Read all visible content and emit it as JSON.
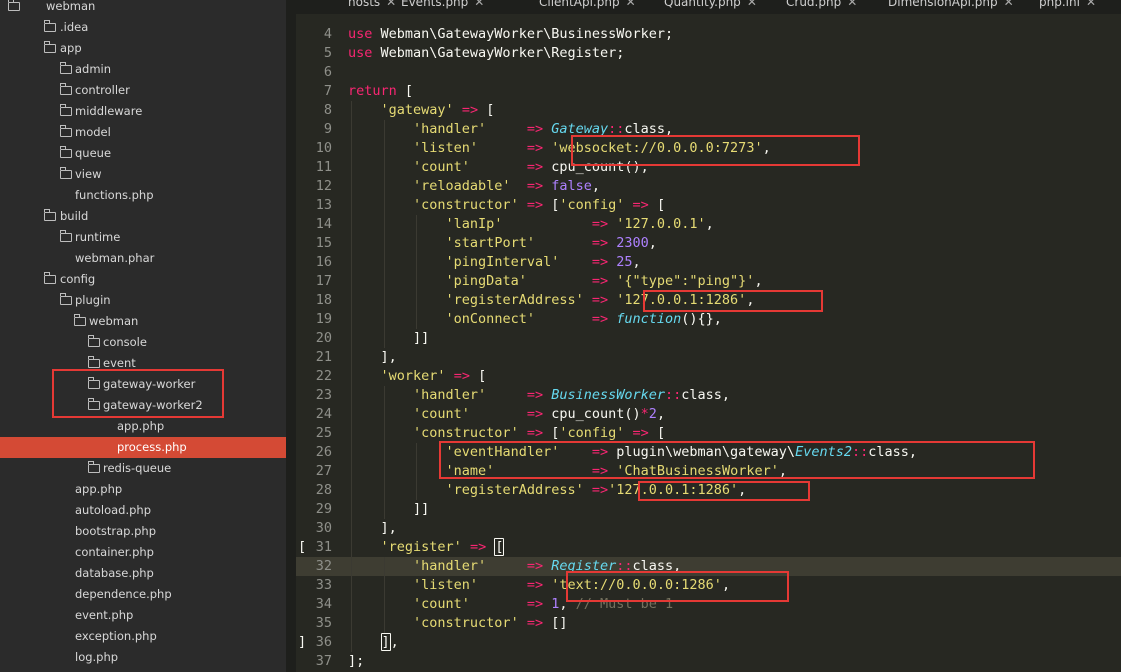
{
  "tabs": [
    {
      "label": "hosts",
      "close": "✕"
    },
    {
      "label": "Events.php",
      "close": "✕"
    },
    {
      "label": "ClientApi.php",
      "close": "✕"
    },
    {
      "label": "Quantity.php",
      "close": "✕"
    },
    {
      "label": "Crud.php",
      "close": "✕"
    },
    {
      "label": "DimensionApi.php",
      "close": "✕"
    },
    {
      "label": "php.ini",
      "close": "✕"
    }
  ],
  "sidebar": {
    "items": [
      {
        "label": "webman",
        "kind": "folder-open"
      },
      {
        "label": ".idea",
        "kind": "folder"
      },
      {
        "label": "app",
        "kind": "folder-open"
      },
      {
        "label": "admin",
        "kind": "folder"
      },
      {
        "label": "controller",
        "kind": "folder"
      },
      {
        "label": "middleware",
        "kind": "folder"
      },
      {
        "label": "model",
        "kind": "folder"
      },
      {
        "label": "queue",
        "kind": "folder"
      },
      {
        "label": "view",
        "kind": "folder"
      },
      {
        "label": "functions.php",
        "kind": "file"
      },
      {
        "label": "build",
        "kind": "folder-open"
      },
      {
        "label": "runtime",
        "kind": "folder"
      },
      {
        "label": "webman.phar",
        "kind": "file"
      },
      {
        "label": "config",
        "kind": "folder-open"
      },
      {
        "label": "plugin",
        "kind": "folder-open"
      },
      {
        "label": "webman",
        "kind": "folder-open"
      },
      {
        "label": "console",
        "kind": "folder"
      },
      {
        "label": "event",
        "kind": "folder"
      },
      {
        "label": "gateway-worker",
        "kind": "folder"
      },
      {
        "label": "gateway-worker2",
        "kind": "folder-open"
      },
      {
        "label": "app.php",
        "kind": "file"
      },
      {
        "label": "process.php",
        "kind": "file",
        "selected": true
      },
      {
        "label": "redis-queue",
        "kind": "folder"
      },
      {
        "label": "app.php",
        "kind": "file"
      },
      {
        "label": "autoload.php",
        "kind": "file"
      },
      {
        "label": "bootstrap.php",
        "kind": "file"
      },
      {
        "label": "container.php",
        "kind": "file"
      },
      {
        "label": "database.php",
        "kind": "file"
      },
      {
        "label": "dependence.php",
        "kind": "file"
      },
      {
        "label": "event.php",
        "kind": "file"
      },
      {
        "label": "exception.php",
        "kind": "file"
      },
      {
        "label": "log.php",
        "kind": "file"
      }
    ]
  },
  "editor": {
    "current_line": "32",
    "lines": [
      {
        "num": "4",
        "tokens": [
          [
            "kw",
            "use"
          ],
          [
            "txt",
            " Webman\\GatewayWorker\\BusinessWorker;"
          ]
        ]
      },
      {
        "num": "5",
        "tokens": [
          [
            "kw",
            "use"
          ],
          [
            "txt",
            " Webman\\GatewayWorker\\Register;"
          ]
        ]
      },
      {
        "num": "6",
        "tokens": []
      },
      {
        "num": "7",
        "tokens": [
          [
            "kw",
            "return"
          ],
          [
            "txt",
            " ["
          ]
        ]
      },
      {
        "num": "8",
        "tokens": [
          [
            "txt",
            "    "
          ],
          [
            "str",
            "'gateway'"
          ],
          [
            "txt",
            " "
          ],
          [
            "op",
            "=>"
          ],
          [
            "txt",
            " ["
          ]
        ]
      },
      {
        "num": "9",
        "tokens": [
          [
            "txt",
            "        "
          ],
          [
            "str",
            "'handler'"
          ],
          [
            "txt",
            "     "
          ],
          [
            "op",
            "=>"
          ],
          [
            "txt",
            " "
          ],
          [
            "cls",
            "Gateway"
          ],
          [
            "op",
            "::"
          ],
          [
            "txt",
            "class,"
          ]
        ]
      },
      {
        "num": "10",
        "tokens": [
          [
            "txt",
            "        "
          ],
          [
            "str",
            "'listen'"
          ],
          [
            "txt",
            "      "
          ],
          [
            "op",
            "=>"
          ],
          [
            "txt",
            " "
          ],
          [
            "str",
            "'websocket://0.0.0.0:7273'"
          ],
          [
            "txt",
            ","
          ]
        ]
      },
      {
        "num": "11",
        "tokens": [
          [
            "txt",
            "        "
          ],
          [
            "str",
            "'count'"
          ],
          [
            "txt",
            "       "
          ],
          [
            "op",
            "=>"
          ],
          [
            "txt",
            " cpu_count(),"
          ]
        ]
      },
      {
        "num": "12",
        "tokens": [
          [
            "txt",
            "        "
          ],
          [
            "str",
            "'reloadable'"
          ],
          [
            "txt",
            "  "
          ],
          [
            "op",
            "=>"
          ],
          [
            "txt",
            " "
          ],
          [
            "num",
            "false"
          ],
          [
            "txt",
            ","
          ]
        ]
      },
      {
        "num": "13",
        "tokens": [
          [
            "txt",
            "        "
          ],
          [
            "str",
            "'constructor'"
          ],
          [
            "txt",
            " "
          ],
          [
            "op",
            "=>"
          ],
          [
            "txt",
            " ["
          ],
          [
            "str",
            "'config'"
          ],
          [
            "txt",
            " "
          ],
          [
            "op",
            "=>"
          ],
          [
            "txt",
            " ["
          ]
        ]
      },
      {
        "num": "14",
        "tokens": [
          [
            "txt",
            "            "
          ],
          [
            "str",
            "'lanIp'"
          ],
          [
            "txt",
            "           "
          ],
          [
            "op",
            "=>"
          ],
          [
            "txt",
            " "
          ],
          [
            "str",
            "'127.0.0.1'"
          ],
          [
            "txt",
            ","
          ]
        ]
      },
      {
        "num": "15",
        "tokens": [
          [
            "txt",
            "            "
          ],
          [
            "str",
            "'startPort'"
          ],
          [
            "txt",
            "       "
          ],
          [
            "op",
            "=>"
          ],
          [
            "txt",
            " "
          ],
          [
            "num",
            "2300"
          ],
          [
            "txt",
            ","
          ]
        ]
      },
      {
        "num": "16",
        "tokens": [
          [
            "txt",
            "            "
          ],
          [
            "str",
            "'pingInterval'"
          ],
          [
            "txt",
            "    "
          ],
          [
            "op",
            "=>"
          ],
          [
            "txt",
            " "
          ],
          [
            "num",
            "25"
          ],
          [
            "txt",
            ","
          ]
        ]
      },
      {
        "num": "17",
        "tokens": [
          [
            "txt",
            "            "
          ],
          [
            "str",
            "'pingData'"
          ],
          [
            "txt",
            "        "
          ],
          [
            "op",
            "=>"
          ],
          [
            "txt",
            " "
          ],
          [
            "str",
            "'{\"type\":\"ping\"}'"
          ],
          [
            "txt",
            ","
          ]
        ]
      },
      {
        "num": "18",
        "tokens": [
          [
            "txt",
            "            "
          ],
          [
            "str",
            "'registerAddress'"
          ],
          [
            "txt",
            " "
          ],
          [
            "op",
            "=>"
          ],
          [
            "txt",
            " "
          ],
          [
            "str",
            "'127.0.0.1:1286'"
          ],
          [
            "txt",
            ","
          ]
        ]
      },
      {
        "num": "19",
        "tokens": [
          [
            "txt",
            "            "
          ],
          [
            "str",
            "'onConnect'"
          ],
          [
            "txt",
            "       "
          ],
          [
            "op",
            "=>"
          ],
          [
            "txt",
            " "
          ],
          [
            "cls",
            "function"
          ],
          [
            "txt",
            "(){},"
          ]
        ]
      },
      {
        "num": "20",
        "tokens": [
          [
            "txt",
            "        ]]"
          ]
        ]
      },
      {
        "num": "21",
        "tokens": [
          [
            "txt",
            "    ],"
          ]
        ]
      },
      {
        "num": "22",
        "tokens": [
          [
            "txt",
            "    "
          ],
          [
            "str",
            "'worker'"
          ],
          [
            "txt",
            " "
          ],
          [
            "op",
            "=>"
          ],
          [
            "txt",
            " ["
          ]
        ]
      },
      {
        "num": "23",
        "tokens": [
          [
            "txt",
            "        "
          ],
          [
            "str",
            "'handler'"
          ],
          [
            "txt",
            "     "
          ],
          [
            "op",
            "=>"
          ],
          [
            "txt",
            " "
          ],
          [
            "cls",
            "BusinessWorker"
          ],
          [
            "op",
            "::"
          ],
          [
            "txt",
            "class,"
          ]
        ]
      },
      {
        "num": "24",
        "tokens": [
          [
            "txt",
            "        "
          ],
          [
            "str",
            "'count'"
          ],
          [
            "txt",
            "       "
          ],
          [
            "op",
            "=>"
          ],
          [
            "txt",
            " cpu_count()"
          ],
          [
            "op",
            "*"
          ],
          [
            "num",
            "2"
          ],
          [
            "txt",
            ","
          ]
        ]
      },
      {
        "num": "25",
        "tokens": [
          [
            "txt",
            "        "
          ],
          [
            "str",
            "'constructor'"
          ],
          [
            "txt",
            " "
          ],
          [
            "op",
            "=>"
          ],
          [
            "txt",
            " ["
          ],
          [
            "str",
            "'config'"
          ],
          [
            "txt",
            " "
          ],
          [
            "op",
            "=>"
          ],
          [
            "txt",
            " ["
          ]
        ]
      },
      {
        "num": "26",
        "tokens": [
          [
            "txt",
            "            "
          ],
          [
            "str",
            "'eventHandler'"
          ],
          [
            "txt",
            "    "
          ],
          [
            "op",
            "=>"
          ],
          [
            "txt",
            " plugin\\webman\\gateway\\"
          ],
          [
            "cls",
            "Events2"
          ],
          [
            "op",
            "::"
          ],
          [
            "txt",
            "class,"
          ]
        ]
      },
      {
        "num": "27",
        "tokens": [
          [
            "txt",
            "            "
          ],
          [
            "str",
            "'name'"
          ],
          [
            "txt",
            "            "
          ],
          [
            "op",
            "=>"
          ],
          [
            "txt",
            " "
          ],
          [
            "str",
            "'ChatBusinessWorker'"
          ],
          [
            "txt",
            ","
          ]
        ]
      },
      {
        "num": "28",
        "tokens": [
          [
            "txt",
            "            "
          ],
          [
            "str",
            "'registerAddress'"
          ],
          [
            "txt",
            " "
          ],
          [
            "op",
            "=>"
          ],
          [
            "str",
            "'127.0.0.1:1286'"
          ],
          [
            "txt",
            ","
          ]
        ]
      },
      {
        "num": "29",
        "tokens": [
          [
            "txt",
            "        ]]"
          ]
        ]
      },
      {
        "num": "30",
        "tokens": [
          [
            "txt",
            "    ],"
          ]
        ]
      },
      {
        "num": "31",
        "tokens": [
          [
            "txt",
            "    "
          ],
          [
            "str",
            "'register'"
          ],
          [
            "txt",
            " "
          ],
          [
            "op",
            "=>"
          ],
          [
            "txt",
            " "
          ],
          [
            "bracket",
            "["
          ]
        ],
        "fold": "["
      },
      {
        "num": "32",
        "tokens": [
          [
            "txt",
            "        "
          ],
          [
            "str",
            "'handler'"
          ],
          [
            "txt",
            "     "
          ],
          [
            "op",
            "=>"
          ],
          [
            "txt",
            " "
          ],
          [
            "cls",
            "Register"
          ],
          [
            "op",
            "::"
          ],
          [
            "txt",
            "class,"
          ]
        ]
      },
      {
        "num": "33",
        "tokens": [
          [
            "txt",
            "        "
          ],
          [
            "str",
            "'listen'"
          ],
          [
            "txt",
            "      "
          ],
          [
            "op",
            "=>"
          ],
          [
            "txt",
            " "
          ],
          [
            "str",
            "'text://0.0.0.0:1286'"
          ],
          [
            "txt",
            ","
          ]
        ]
      },
      {
        "num": "34",
        "tokens": [
          [
            "txt",
            "        "
          ],
          [
            "str",
            "'count'"
          ],
          [
            "txt",
            "       "
          ],
          [
            "op",
            "=>"
          ],
          [
            "txt",
            " "
          ],
          [
            "num",
            "1"
          ],
          [
            "txt",
            ", "
          ],
          [
            "cmt",
            "// Must be 1"
          ]
        ]
      },
      {
        "num": "35",
        "tokens": [
          [
            "txt",
            "        "
          ],
          [
            "str",
            "'constructor'"
          ],
          [
            "txt",
            " "
          ],
          [
            "op",
            "=>"
          ],
          [
            "txt",
            " []"
          ]
        ]
      },
      {
        "num": "36",
        "tokens": [
          [
            "txt",
            "    "
          ],
          [
            "bracket",
            "]"
          ],
          [
            "txt",
            ","
          ]
        ],
        "fold": "]"
      },
      {
        "num": "37",
        "tokens": [
          [
            "txt",
            "];"
          ]
        ]
      }
    ]
  },
  "colors": {
    "background": "#272822",
    "sidebar": "#2b2b2b",
    "selected_row": "#d44a35",
    "annotation_box": "#e53935",
    "string": "#e6db74",
    "keyword": "#f92672",
    "class": "#66d9ef",
    "number": "#ae81ff"
  }
}
